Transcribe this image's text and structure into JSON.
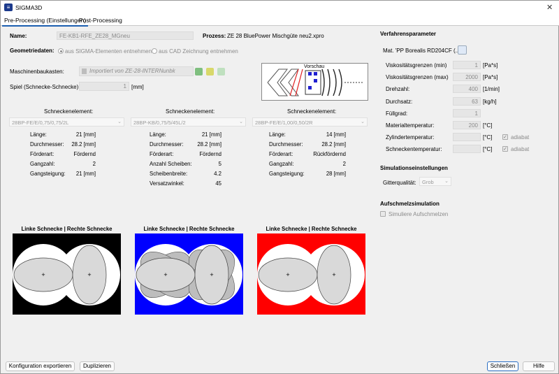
{
  "window": {
    "title": "SIGMA3D",
    "icon": "sigma-app-icon"
  },
  "tabs": [
    {
      "label": "Pre-Processing (Einstellungen)",
      "active": true
    },
    {
      "label": "Post-Processing",
      "active": false
    }
  ],
  "left": {
    "name_label": "Name:",
    "name_value": "FE-KB1-RFE_ZE28_MGneu",
    "prozess_label": "Prozess:",
    "prozess_value": "ZE 28 BluePower Mischgüte neu2.xpro",
    "geom_label": "Geometriedaten:",
    "geom_opt1": "aus SIGMA-Elementen entnehmen",
    "geom_opt2": "aus CAD Zeichnung entnehmen",
    "maschinen_label": "Maschinenbaukasten:",
    "maschinen_value": "Importiert von ZE-28-INTERNunbk",
    "spiel_label": "Spiel (Schnecke-Schnecke):",
    "spiel_value": "1",
    "spiel_unit": "[mm]",
    "vorschau_label": "Vorschau"
  },
  "elements": [
    {
      "header": "Schneckenelement:",
      "combo": "28BP-FE/E/0,75/0,75/2L",
      "rows": [
        {
          "label": "Länge:",
          "value": "21 [mm]"
        },
        {
          "label": "Durchmesser:",
          "value": "28.2 [mm]"
        },
        {
          "label": "Förderart:",
          "value": "Fördernd"
        },
        {
          "label": "Gangzahl:",
          "value": "2"
        },
        {
          "label": "Gangsteigung:",
          "value": "21 [mm]"
        }
      ],
      "panel_title": "Linke Schnecke | Rechte Schnecke",
      "bg": "#000000"
    },
    {
      "header": "Schneckenelement:",
      "combo": "28BP-KB/0,75/5/45L/2",
      "rows": [
        {
          "label": "Länge:",
          "value": "21 [mm]"
        },
        {
          "label": "Durchmesser:",
          "value": "28.2 [mm]"
        },
        {
          "label": "Förderart:",
          "value": "Fördernd"
        },
        {
          "label": "Anzahl Scheiben:",
          "value": "5"
        },
        {
          "label": "Scheibenbreite:",
          "value": "4.2"
        },
        {
          "label": "Versatzwinkel:",
          "value": "45"
        }
      ],
      "panel_title": "Linke Schnecke | Rechte Schnecke",
      "bg": "#0000ff"
    },
    {
      "header": "Schneckenelement:",
      "combo": "28BP-FE/E/1,00/0,50/2R",
      "rows": [
        {
          "label": "Länge:",
          "value": "14 [mm]"
        },
        {
          "label": "Durchmesser:",
          "value": "28.2 [mm]"
        },
        {
          "label": "Förderart:",
          "value": "Rückfördernd"
        },
        {
          "label": "Gangzahl:",
          "value": "2"
        },
        {
          "label": "Gangsteigung:",
          "value": "28 [mm]"
        }
      ],
      "panel_title": "Linke Schnecke | Rechte Schnecke",
      "bg": "#ff0000"
    }
  ],
  "right": {
    "verfahren_header": "Verfahrensparameter",
    "mat_label": "Mat. 'PP Borealis RD204CF (...'",
    "params": [
      {
        "label": "Viskositätsgrenzen (min)",
        "value": "1",
        "unit": "[Pa*s]"
      },
      {
        "label": "Viskositätsgrenzen (max)",
        "value": "2000",
        "unit": "[Pa*s]"
      },
      {
        "label": "Drehzahl:",
        "value": "400",
        "unit": "[1/min]"
      },
      {
        "label": "Durchsatz:",
        "value": "63",
        "unit": "[kg/h]"
      },
      {
        "label": "Füllgrad:",
        "value": "1",
        "unit": ""
      },
      {
        "label": "Materialtemperatur:",
        "value": "200",
        "unit": "[°C]"
      },
      {
        "label": "Zylindertemperatur:",
        "value": "",
        "unit": "[°C]",
        "adiabat": "adiabat"
      },
      {
        "label": "Schneckentemperatur:",
        "value": "",
        "unit": "[°C]",
        "adiabat": "adiabat"
      }
    ],
    "sim_header": "Simulationseinstellungen",
    "gitter_label": "Gitterqualität:",
    "gitter_value": "Grob",
    "aufschmelz_header": "Aufschmelzsimulation",
    "aufschmelz_chk": "Simuliere Aufschmelzen"
  },
  "footer": {
    "export": "Konfiguration exportieren",
    "duplizieren": "Duplizieren",
    "schliessen": "Schließen",
    "hilfe": "Hilfe"
  }
}
